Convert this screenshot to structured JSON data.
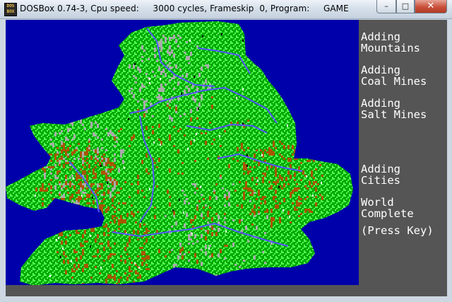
{
  "window": {
    "title": "DOSBox 0.74-3, Cpu speed:     3000 cycles, Frameskip  0, Program:     GAME",
    "icon": "dosbox-icon",
    "controls": {
      "minimize": "–",
      "maximize": "□",
      "close": "✕"
    }
  },
  "colors": {
    "sea": "#0000aa",
    "land": "#00aa00",
    "grassland": "#55ff55",
    "hills": "#aa5500",
    "mountains": "#aaaaaa",
    "rivers": "#5555ff",
    "cities": "#ffffff",
    "panel": "#555555",
    "text": "#ffffff"
  },
  "messages": [
    {
      "line1": "Adding",
      "line2": "Mountains"
    },
    {
      "line1": "Adding",
      "line2": "Coal Mines"
    },
    {
      "line1": "Adding",
      "line2": "Salt Mines"
    },
    {
      "line1": "Adding",
      "line2": "Cities"
    },
    {
      "line1": "World",
      "line2": "Complete"
    }
  ],
  "prompt": "(Press Key)"
}
